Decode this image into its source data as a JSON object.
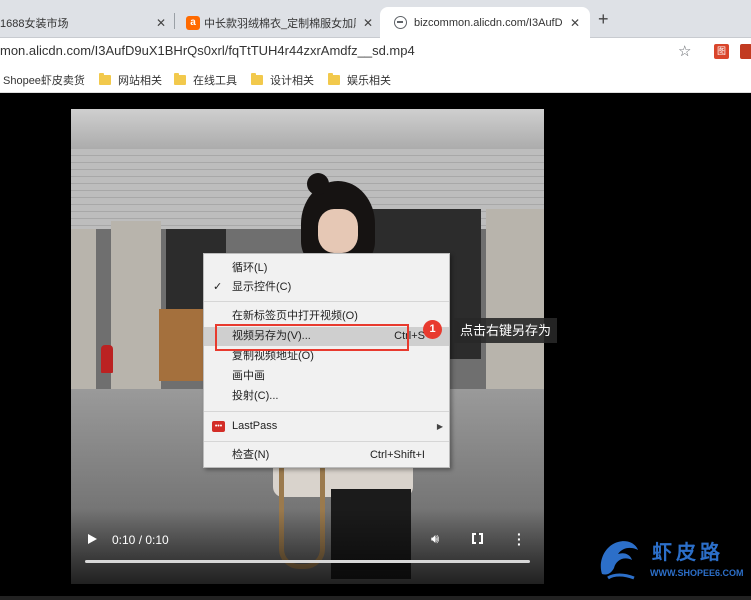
{
  "browser": {
    "tabs": [
      {
        "title": "1688女装市场",
        "close": "✕"
      },
      {
        "title": "中长款羽绒棉衣_定制棉服女加厚",
        "close": "✕"
      },
      {
        "title": "bizcommon.alicdn.com/I3AufD",
        "close": "✕"
      }
    ],
    "new_tab": "+",
    "url": "mon.alicdn.com/I3AufD9uX1BHrQs0xrl/fqTtTUH4r44zxrAmdfz__sd.mp4",
    "bookmarks": [
      "Shopee虾皮卖货",
      "网站相关",
      "在线工具",
      "设计相关",
      "娱乐相关"
    ]
  },
  "video": {
    "time": "0:10 / 0:10",
    "progress": 1.0
  },
  "context_menu": {
    "items": [
      {
        "label": "循环(L)",
        "shortcut": ""
      },
      {
        "label": "显示控件(C)",
        "shortcut": "",
        "checked": true
      },
      {
        "label": "在新标签页中打开视频(O)",
        "shortcut": ""
      },
      {
        "label": "视频另存为(V)...",
        "shortcut": "Ctrl+S",
        "highlighted": true
      },
      {
        "label": "复制视频地址(O)",
        "shortcut": ""
      },
      {
        "label": "画中画",
        "shortcut": ""
      },
      {
        "label": "投射(C)...",
        "shortcut": ""
      },
      {
        "label": "LastPass",
        "shortcut": ""
      },
      {
        "label": "检查(N)",
        "shortcut": "Ctrl+Shift+I"
      }
    ],
    "lastpass_icon": "•••"
  },
  "annotation": {
    "step": "1",
    "tip": "点击右键另存为"
  },
  "watermark": {
    "title": "虾皮路",
    "url": "WWW.SHOPEE6.COM"
  },
  "colors": {
    "annotation_red": "#e83a2e",
    "watermark_blue": "#2c6fc9"
  }
}
